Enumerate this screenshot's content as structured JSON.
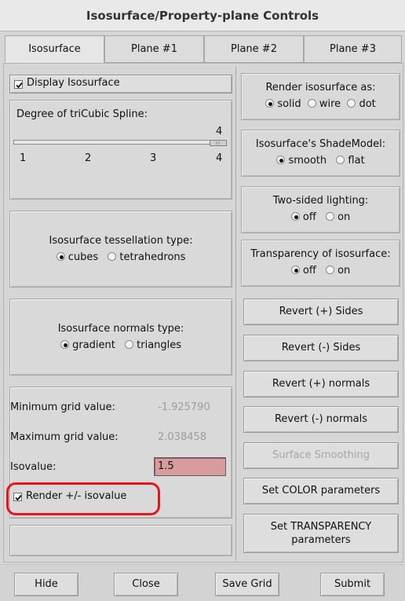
{
  "window": {
    "title": "Isosurface/Property-plane Controls"
  },
  "tabs": [
    "Isosurface",
    "Plane #1",
    "Plane #2",
    "Plane #3"
  ],
  "left": {
    "display_isosurface": {
      "label": "Display Isosurface",
      "checked": true
    },
    "spline": {
      "label": "Degree of triCubic Spline:",
      "value": "4",
      "ticks": [
        "1",
        "2",
        "3",
        "4"
      ]
    },
    "tessellation": {
      "label": "Isosurface tessellation type:",
      "options": [
        "cubes",
        "tetrahedrons"
      ],
      "selected": "cubes"
    },
    "normals": {
      "label": "Isosurface normals type:",
      "options": [
        "gradient",
        "triangles"
      ],
      "selected": "gradient"
    },
    "grid": {
      "min_label": "Minimum grid value:",
      "min_value": "-1.925790",
      "max_label": "Maximum grid value:",
      "max_value": "2.038458",
      "iso_label": "Isovalue:",
      "iso_value": "1.5"
    },
    "render_pm": {
      "label": "Render +/- isovalue",
      "checked": true
    }
  },
  "right": {
    "render_as": {
      "label": "Render isosurface as:",
      "options": [
        "solid",
        "wire",
        "dot"
      ],
      "selected": "solid"
    },
    "shade": {
      "label": "Isosurface's ShadeModel:",
      "options": [
        "smooth",
        "flat"
      ],
      "selected": "smooth"
    },
    "two_sided": {
      "label": "Two-sided lighting:",
      "options": [
        "off",
        "on"
      ],
      "selected": "off"
    },
    "transparency": {
      "label": "Transparency of isosurface:",
      "options": [
        "off",
        "on"
      ],
      "selected": "off"
    },
    "buttons": {
      "revert_plus_sides": "Revert (+) Sides",
      "revert_minus_sides": "Revert (-) Sides",
      "revert_plus_normals": "Revert (+) normals",
      "revert_minus_normals": "Revert (-) normals",
      "surface_smoothing": "Surface Smoothing",
      "set_color": "Set COLOR parameters",
      "set_transparency_line1": "Set TRANSPARENCY",
      "set_transparency_line2": "parameters"
    }
  },
  "footer": {
    "hide": "Hide",
    "close": "Close",
    "save_grid": "Save Grid",
    "submit": "Submit"
  },
  "colors": {
    "isovalue_bg": "#d89c9c",
    "highlight": "#e8141c"
  }
}
